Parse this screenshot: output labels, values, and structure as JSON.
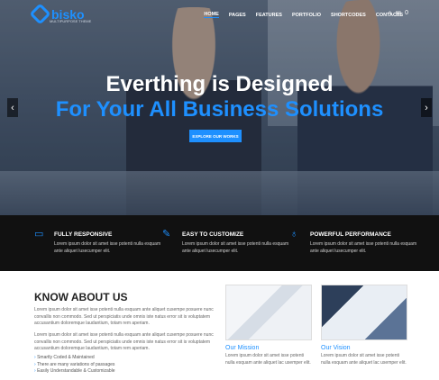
{
  "header": {
    "logo_text": "bisko",
    "logo_tagline": "MULTIPURPOSE THEME",
    "nav": [
      "HOME",
      "PAGES",
      "FEATURES",
      "PORTFOLIO",
      "SHORTCODES",
      "CONTACTS"
    ],
    "cart_count": "0"
  },
  "hero": {
    "title": "Everthing is Designed",
    "subtitle": "For Your All Business Solutions",
    "button": "EXPLORE OUR WORKS",
    "prev": "‹",
    "next": "›"
  },
  "features": [
    {
      "icon": "monitor-icon",
      "title": "FULLY RESPONSIVE",
      "text": "Lorem ipsum dolor sit amet isse potenti nulla esquam ante aliquet lusecumper elit."
    },
    {
      "icon": "edit-icon",
      "title": "EASY TO CUSTOMIZE",
      "text": "Lorem ipsum dolor sit amet isse potenti nulla esquam ante aliquet lusecumper elit."
    },
    {
      "icon": "bulb-icon",
      "title": "POWERFUL PERFORMANCE",
      "text": "Lorem ipsum dolor sit amet isse potenti nulla esquam ante aliquet lusecumper elit."
    }
  ],
  "about": {
    "title": "KNOW ABOUT US",
    "p1": "Lorem ipsum dolor sit amet isse potenti nulla esquam ante aliquet cusempe posuere nunc convallis non commodo. Sed ut perspiciatis unde omnis iste natus error sit is voluptatem accusantium doloremque laudantium, totam rem aperiam.",
    "p2": "Lorem ipsum dolor sit amet isse potenti nulla esquam ante aliquet cusempe posuere nunc convallis non commodo. Sed ut perspiciatis unde omnis iste natus error sit is voluptatem accusantium doloremque laudantium, totam rem aperiam.",
    "list": [
      "Smartly Coded & Maintained",
      "There are many variations of passages",
      "Easily Understandable & Customizable"
    ]
  },
  "cards": [
    {
      "title": "Our Mission",
      "text": "Lorem ipsum dolor sit amet isse potenti nulla esquam ante aliquet lac usemper elit."
    },
    {
      "title": "Our Vision",
      "text": "Lorem ipsum dolor sit amet isse potenti nulla esquam ante aliquet lac usemper elit."
    }
  ],
  "colors": {
    "accent": "#1e90ff",
    "dark": "#111111"
  }
}
